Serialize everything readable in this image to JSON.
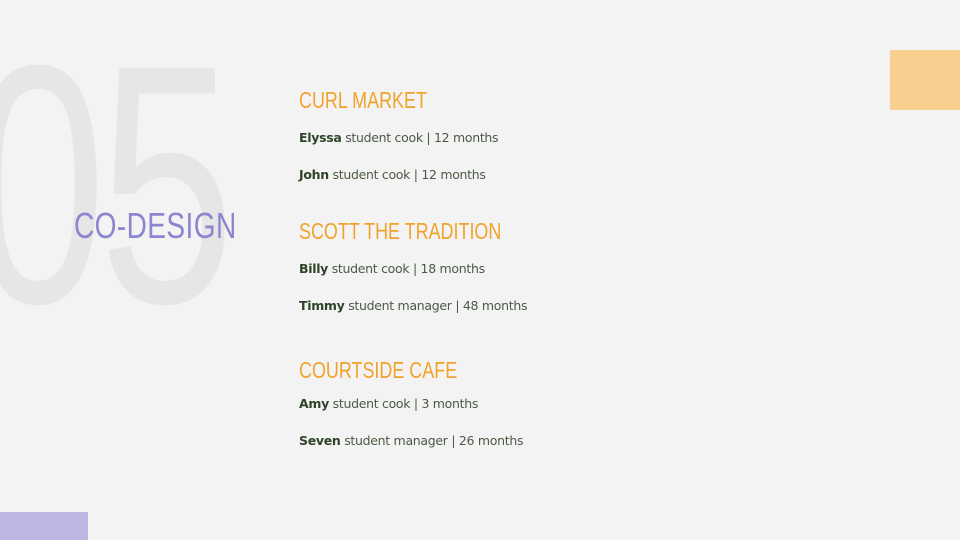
{
  "background_number": "05",
  "section_title": "CO-DESIGN",
  "groups": [
    {
      "title": "CURL MARKET",
      "people": [
        {
          "name": "Elyssa",
          "role": "student cook | 12 months"
        },
        {
          "name": "John",
          "role": "student cook | 12 months"
        }
      ]
    },
    {
      "title": "SCOTT THE TRADITION",
      "people": [
        {
          "name": "Billy",
          "role": "student cook | 18 months"
        },
        {
          "name": "Timmy",
          "role": "student manager | 48 months"
        }
      ]
    },
    {
      "title": "COURTSIDE CAFE",
      "people": [
        {
          "name": "Amy",
          "role": "student cook | 3 months"
        },
        {
          "name": "Seven",
          "role": "student manager | 26 months"
        }
      ]
    }
  ],
  "colors": {
    "background": "#f3f3f3",
    "heading_orange": "#f1a22b",
    "section_purple": "#8b86cf",
    "name_green": "#2e4428",
    "deco_orange": "#f8cf8f",
    "deco_purple": "#bbb7e2"
  }
}
